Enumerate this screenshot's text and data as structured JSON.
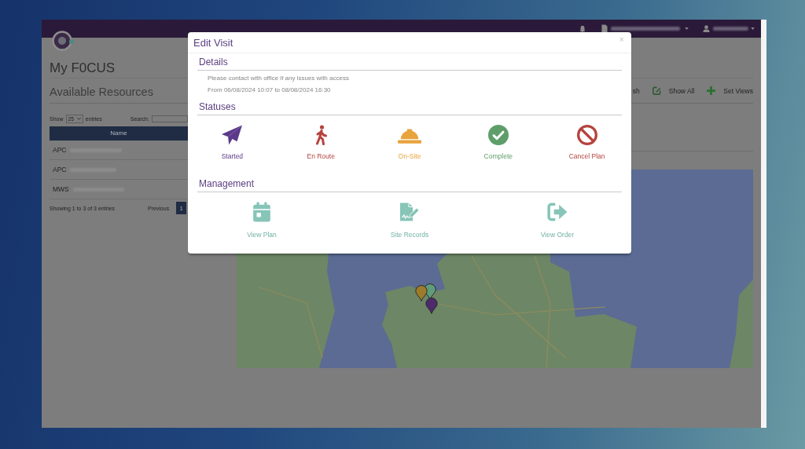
{
  "page": {
    "title": "My F0CUS",
    "section_title": "Available Resources"
  },
  "table_controls": {
    "show_label": "Show",
    "page_size": "25",
    "entries_label": "entries",
    "search_label": "Search:"
  },
  "table": {
    "columns": [
      "Name"
    ],
    "rows": [
      {
        "code": "APC"
      },
      {
        "code": "APC"
      },
      {
        "code": "MWS"
      }
    ]
  },
  "pagination": {
    "summary": "Showing 1 to 3 of 3 entries",
    "previous": "Previous",
    "pages": [
      {
        "label": "1",
        "selected": true
      }
    ]
  },
  "toolbar": {
    "items": [
      {
        "label": "sh"
      },
      {
        "label": "Show All"
      },
      {
        "label": "Set Views"
      }
    ]
  },
  "map": {
    "markers": [
      {
        "color": "#9c7c2c"
      },
      {
        "color": "#5f9c7c"
      },
      {
        "color": "#4d2a6a"
      }
    ]
  },
  "modal": {
    "title": "Edit Visit",
    "close": "×",
    "details": {
      "heading": "Details",
      "lines": [
        "Please contact with office if any issues with access",
        "From 06/08/2024 10:07 to 08/08/2024 16:30"
      ]
    },
    "statuses": {
      "heading": "Statuses",
      "items": [
        {
          "label": "Started",
          "color": "#5b3a8a"
        },
        {
          "label": "En Route",
          "color": "#b5443e"
        },
        {
          "label": "On-Site",
          "color": "#e8a33d"
        },
        {
          "label": "Complete",
          "color": "#5e9e6a"
        },
        {
          "label": "Cancel Plan",
          "color": "#b5443e"
        }
      ]
    },
    "management": {
      "heading": "Management",
      "items": [
        {
          "label": "View Plan"
        },
        {
          "label": "Site Records"
        },
        {
          "label": "View Order"
        }
      ]
    }
  }
}
